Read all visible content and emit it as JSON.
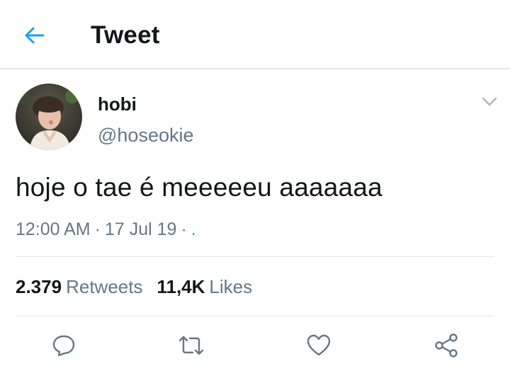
{
  "header": {
    "title": "Tweet",
    "back_icon": "arrow-left-icon"
  },
  "colors": {
    "accent": "#1da1f2",
    "secondary_text": "#657786",
    "divider": "#e1e8ed"
  },
  "tweet": {
    "author_name": "hobi",
    "author_handle": "@hoseokie",
    "text": "hoje o tae é meeeeeu aaaaaaa",
    "time": "12:00 AM",
    "date": "17 Jul 19",
    "sep1": "·",
    "sep2": "·",
    "source": ".",
    "retweets_count": "2.379",
    "retweets_label": "Retweets",
    "likes_count": "11,4K",
    "likes_label": "Likes"
  },
  "actions": [
    {
      "icon": "reply-icon"
    },
    {
      "icon": "retweet-icon"
    },
    {
      "icon": "like-icon"
    },
    {
      "icon": "share-icon"
    }
  ]
}
